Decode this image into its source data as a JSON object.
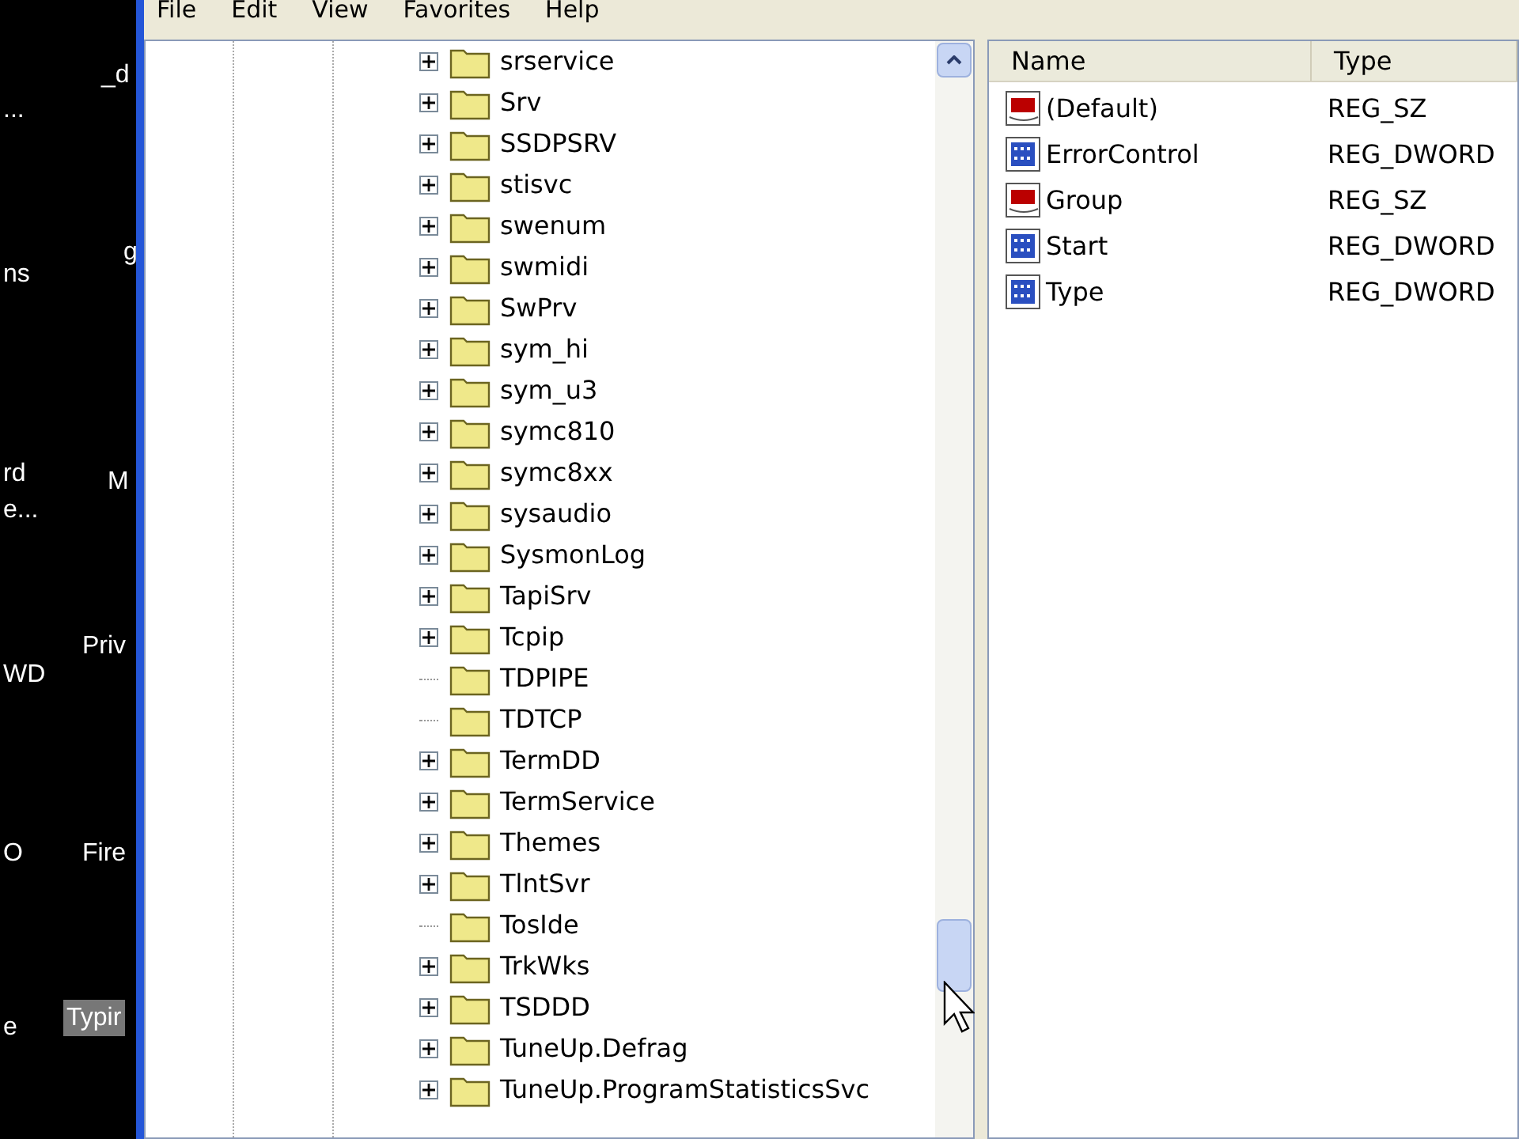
{
  "desktop_icons": [
    {
      "label": "_d",
      "selected": false
    },
    {
      "label": "...",
      "selected": false
    },
    {
      "label": "g",
      "selected": false
    },
    {
      "label": "ns",
      "selected": false
    },
    {
      "label": "rd\ne...",
      "selected": false
    },
    {
      "label": "M",
      "selected": false
    },
    {
      "label": "Priv",
      "selected": false
    },
    {
      "label": "WD",
      "selected": false
    },
    {
      "label": "O",
      "selected": false
    },
    {
      "label": "Fire",
      "selected": false
    },
    {
      "label": "e",
      "selected": false
    },
    {
      "label": "Typir",
      "selected": true
    }
  ],
  "menu": [
    "File",
    "Edit",
    "View",
    "Favorites",
    "Help"
  ],
  "tree": [
    {
      "label": "srservice",
      "expandable": true
    },
    {
      "label": "Srv",
      "expandable": true
    },
    {
      "label": "SSDPSRV",
      "expandable": true
    },
    {
      "label": "stisvc",
      "expandable": true
    },
    {
      "label": "swenum",
      "expandable": true
    },
    {
      "label": "swmidi",
      "expandable": true
    },
    {
      "label": "SwPrv",
      "expandable": true
    },
    {
      "label": "sym_hi",
      "expandable": true
    },
    {
      "label": "sym_u3",
      "expandable": true
    },
    {
      "label": "symc810",
      "expandable": true
    },
    {
      "label": "symc8xx",
      "expandable": true
    },
    {
      "label": "sysaudio",
      "expandable": true
    },
    {
      "label": "SysmonLog",
      "expandable": true
    },
    {
      "label": "TapiSrv",
      "expandable": true
    },
    {
      "label": "Tcpip",
      "expandable": true
    },
    {
      "label": "TDPIPE",
      "expandable": false
    },
    {
      "label": "TDTCP",
      "expandable": false
    },
    {
      "label": "TermDD",
      "expandable": true
    },
    {
      "label": "TermService",
      "expandable": true
    },
    {
      "label": "Themes",
      "expandable": true
    },
    {
      "label": "TlntSvr",
      "expandable": true
    },
    {
      "label": "TosIde",
      "expandable": false
    },
    {
      "label": "TrkWks",
      "expandable": true
    },
    {
      "label": "TSDDD",
      "expandable": true
    },
    {
      "label": "TuneUp.Defrag",
      "expandable": true
    },
    {
      "label": "TuneUp.ProgramStatisticsSvc",
      "expandable": true
    }
  ],
  "values_table": {
    "columns": [
      "Name",
      "Type"
    ],
    "rows": [
      {
        "kind": "string",
        "name": "(Default)",
        "type": "REG_SZ"
      },
      {
        "kind": "dword",
        "name": "ErrorControl",
        "type": "REG_DWORD"
      },
      {
        "kind": "string",
        "name": "Group",
        "type": "REG_SZ"
      },
      {
        "kind": "dword",
        "name": "Start",
        "type": "REG_DWORD"
      },
      {
        "kind": "dword",
        "name": "Type",
        "type": "REG_DWORD"
      }
    ]
  }
}
